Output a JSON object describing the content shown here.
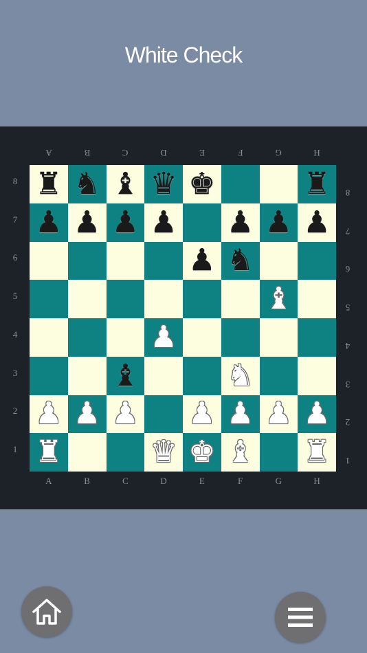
{
  "title": "White Check",
  "files": [
    "A",
    "B",
    "C",
    "D",
    "E",
    "F",
    "G",
    "H"
  ],
  "ranks": [
    "8",
    "7",
    "6",
    "5",
    "4",
    "3",
    "2",
    "1"
  ],
  "board": [
    [
      "bR",
      "bN",
      "bB",
      "bQ",
      "bK",
      "",
      "",
      "bR"
    ],
    [
      "bP",
      "bP",
      "bP",
      "bP",
      "",
      "bP",
      "bP",
      "bP"
    ],
    [
      "",
      "",
      "",
      "",
      "bP",
      "bN",
      "",
      ""
    ],
    [
      "",
      "",
      "",
      "",
      "",
      "",
      "wB",
      ""
    ],
    [
      "",
      "",
      "",
      "wP",
      "",
      "",
      "",
      ""
    ],
    [
      "",
      "",
      "bB",
      "",
      "",
      "wN",
      "",
      ""
    ],
    [
      "wP",
      "wP",
      "wP",
      "",
      "wP",
      "wP",
      "wP",
      "wP"
    ],
    [
      "wR",
      "",
      "",
      "wQ",
      "wK",
      "wB",
      "",
      "wR"
    ]
  ],
  "colors": {
    "background": "#7b8ba4",
    "panel": "#1d2128",
    "light_square": "#fdfde0",
    "dark_square": "#0e8282",
    "button": "#6f6f72"
  },
  "buttons": {
    "home_icon": "home-icon",
    "menu_icon": "hamburger-menu-icon"
  }
}
